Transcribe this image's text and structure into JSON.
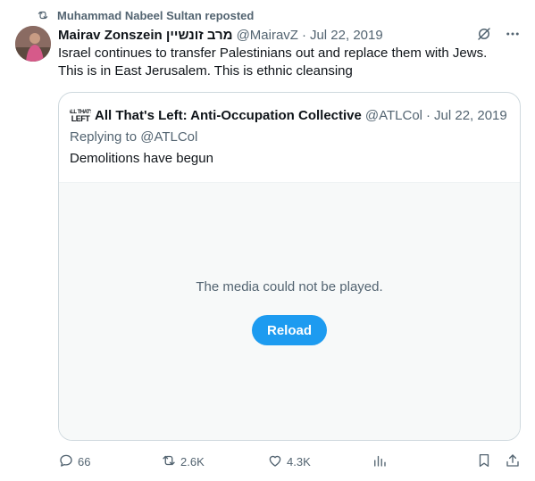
{
  "repost": {
    "text": "Muhammad Nabeel Sultan reposted",
    "icon": "repost-icon"
  },
  "tweet": {
    "author_name": "Mairav Zonszein מרב זונשיין",
    "handle": "@MairavZ",
    "separator": "·",
    "date": "Jul 22, 2019",
    "text_line1": "Israel continues to transfer Palestinians out and replace them with Jews.",
    "text_line2": "This is in East Jerusalem. This is ethnic cleansing"
  },
  "quote": {
    "logo_text": "All That's Left",
    "author_name": "All That's Left: Anti-Occupation Collective",
    "handle": "@ATLCol",
    "separator": "·",
    "date": "Jul 22, 2019",
    "replying_prefix": "Replying to",
    "replying_handle": "@ATLCol",
    "text": "Demolitions have begun",
    "media_message": "The media could not be played.",
    "reload_label": "Reload"
  },
  "actions": {
    "replies": "66",
    "reposts": "2.6K",
    "likes": "4.3K"
  },
  "colors": {
    "accent": "#1d9bf0",
    "muted": "#536471",
    "border": "#cfd9de",
    "media_bg": "#f7f9f9"
  }
}
